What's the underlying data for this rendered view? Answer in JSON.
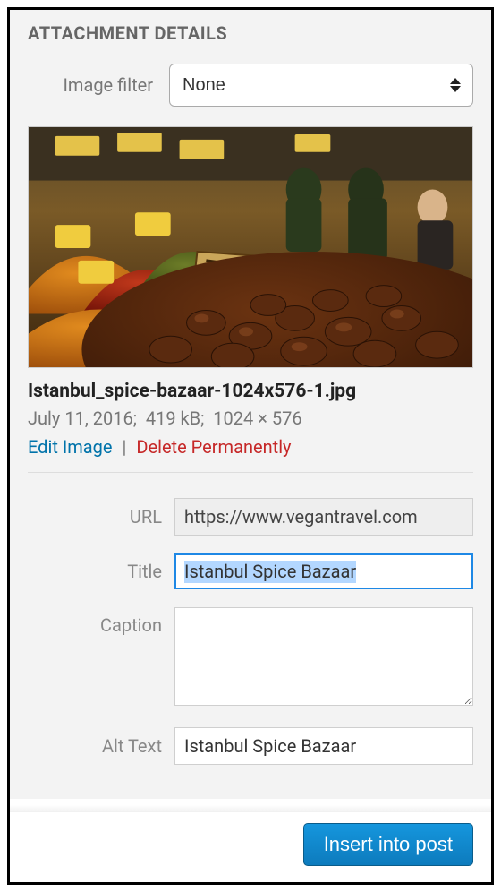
{
  "panel": {
    "title": "ATTACHMENT DETAILS",
    "image_filter_label": "Image filter",
    "image_filter_value": "None"
  },
  "attachment": {
    "filename": "Istanbul_spice-bazaar-1024x576-1.jpg",
    "date": "July 11, 2016",
    "size": "419 kB",
    "dimensions": "1024 × 576"
  },
  "actions": {
    "edit": "Edit Image",
    "delete": "Delete Permanently",
    "divider": "|"
  },
  "fields": {
    "url_label": "URL",
    "url_value": "https://www.vegantravel.com",
    "title_label": "Title",
    "title_value": "Istanbul Spice Bazaar",
    "caption_label": "Caption",
    "caption_value": "",
    "alt_label": "Alt Text",
    "alt_value": "Istanbul Spice Bazaar"
  },
  "footer": {
    "insert_label": "Insert into post"
  }
}
